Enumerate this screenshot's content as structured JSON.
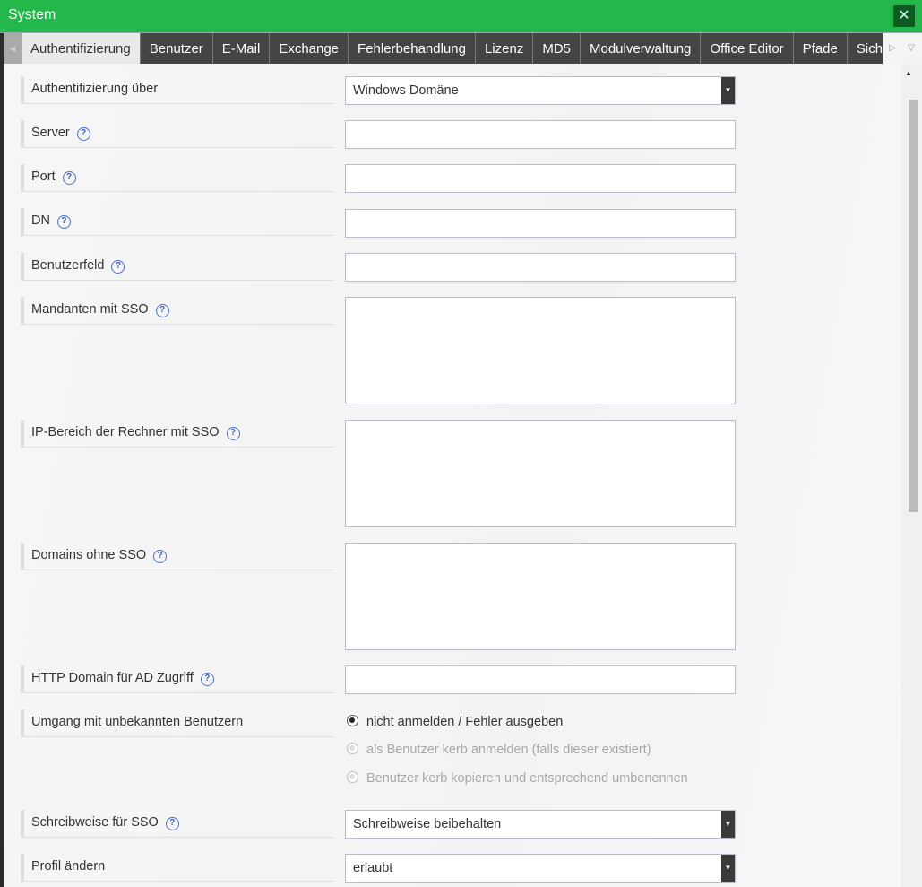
{
  "window": {
    "title": "System",
    "close_icon": "close-icon"
  },
  "tabs": [
    "Authentifizierung",
    "Benutzer",
    "E-Mail",
    "Exchange",
    "Fehlerbehandlung",
    "Lizenz",
    "MD5",
    "Modulverwaltung",
    "Office Editor",
    "Pfade",
    "Sicherh"
  ],
  "active_tab": "Authentifizierung",
  "form": {
    "auth_label": "Authentifizierung über",
    "auth_value": "Windows Domäne",
    "server_label": "Server",
    "port_label": "Port",
    "dn_label": "DN",
    "userfield_label": "Benutzerfeld",
    "mandanten_label": "Mandanten mit SSO",
    "ip_label": "IP-Bereich der Rechner mit SSO",
    "domains_label": "Domains ohne SSO",
    "http_label": "HTTP Domain für AD Zugriff",
    "unknown_label": "Umgang mit unbekannten Benutzern",
    "unknown_options": [
      "nicht anmelden / Fehler ausgeben",
      "als Benutzer kerb anmelden (falls dieser existiert)",
      "Benutzer kerb kopieren und entsprechend umbenennen"
    ],
    "sso_case_label": "Schreibweise für SSO",
    "sso_case_value": "Schreibweise beibehalten",
    "profile_label": "Profil ändern",
    "profile_value": "erlaubt",
    "help_glyph": "?"
  },
  "colors": {
    "titlebar": "#22b94a",
    "tabbar": "#444444",
    "help": "#3a5fc8"
  }
}
